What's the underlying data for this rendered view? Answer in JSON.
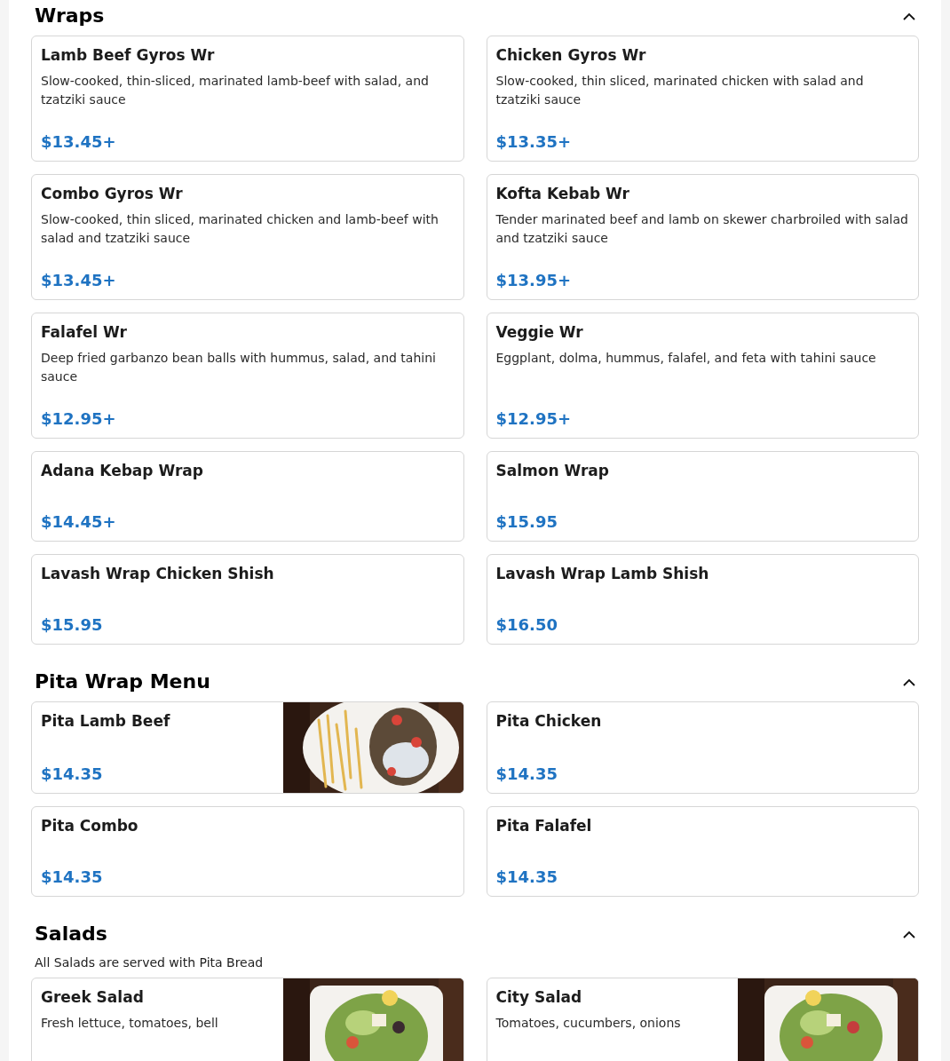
{
  "sections": [
    {
      "title": "Wraps",
      "expanded": true,
      "items": [
        {
          "name": "Lamb Beef Gyros Wr",
          "description": "Slow-cooked, thin-sliced, marinated lamb-beef with salad, and tzatziki sauce",
          "price": "$13.45+"
        },
        {
          "name": "Chicken Gyros Wr",
          "description": "Slow-cooked, thin sliced, marinated chicken with salad and tzatziki sauce",
          "price": "$13.35+"
        },
        {
          "name": "Combo Gyros Wr",
          "description": "Slow-cooked, thin sliced, marinated chicken and lamb-beef with salad and tzatziki sauce",
          "price": "$13.45+"
        },
        {
          "name": "Kofta Kebab Wr",
          "description": "Tender marinated beef and lamb on skewer charbroiled with salad and tzatziki sauce",
          "price": "$13.95+"
        },
        {
          "name": "Falafel Wr",
          "description": "Deep fried garbanzo bean balls with hummus, salad, and tahini sauce",
          "price": "$12.95+"
        },
        {
          "name": "Veggie Wr",
          "description": "Eggplant, dolma, hummus, falafel, and feta with tahini sauce",
          "price": "$12.95+"
        },
        {
          "name": "Adana Kebap Wrap",
          "price": "$14.45+"
        },
        {
          "name": "Salmon Wrap",
          "price": "$15.95"
        },
        {
          "name": "Lavash Wrap Chicken Shish",
          "price": "$15.95"
        },
        {
          "name": "Lavash Wrap Lamb Shish",
          "price": "$16.50"
        }
      ]
    },
    {
      "title": "Pita Wrap Menu",
      "expanded": true,
      "items": [
        {
          "name": "Pita Lamb Beef",
          "price": "$14.35"
        },
        {
          "name": "Pita Chicken",
          "price": "$14.35"
        },
        {
          "name": "Pita Combo",
          "price": "$14.35"
        },
        {
          "name": "Pita Falafel",
          "price": "$14.35"
        }
      ]
    },
    {
      "title": "Salads",
      "expanded": true,
      "note": "All Salads are served with Pita Bread",
      "items": [
        {
          "name": "Greek Salad",
          "description": "Fresh lettuce, tomatoes, bell"
        },
        {
          "name": "City Salad",
          "description": "Tomatoes, cucumbers, onions"
        }
      ]
    }
  ]
}
